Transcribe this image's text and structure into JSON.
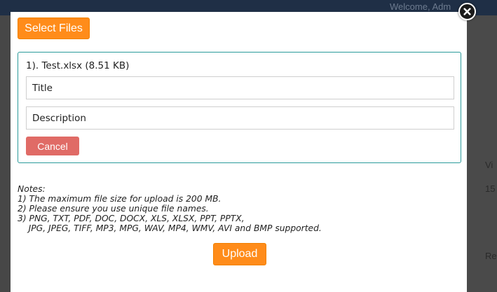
{
  "background": {
    "welcome_text": "Welcome, Adm",
    "right_panel_items": [
      "Vi",
      "15",
      "Re"
    ]
  },
  "dialog": {
    "select_files_label": "Select Files",
    "file": {
      "name": "1). Test.xlsx (8.51 KB)",
      "title_value": "Title",
      "description_value": "Description",
      "cancel_label": "Cancel"
    },
    "notes": {
      "heading": "Notes:",
      "lines": [
        "1) The maximum file size for upload is 200 MB.",
        "2) Please ensure you use unique file names.",
        "3) PNG, TXT, PDF, DOC, DOCX, XLS, XLSX, PPT, PPTX,",
        "    JPG, JPEG, TIFF, MP3, MPG, WAV, MP4, WMV, AVI and BMP supported."
      ]
    },
    "upload_label": "Upload"
  },
  "icons": {
    "close": "close-icon"
  },
  "colors": {
    "accent_orange": "#ff8c1a",
    "cancel_red": "#e06b66",
    "card_border_teal": "#2b9a9a"
  }
}
